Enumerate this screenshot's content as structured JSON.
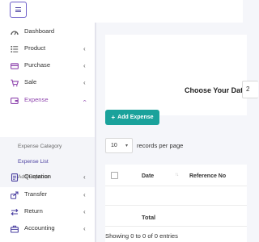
{
  "topbar": {
    "menu_icon": "hamburger-icon"
  },
  "sidebar": {
    "items": [
      {
        "label": "Dashboard",
        "icon": "gauge-icon",
        "has_submenu": false
      },
      {
        "label": "Product",
        "icon": "list-icon",
        "has_submenu": true
      },
      {
        "label": "Purchase",
        "icon": "card-icon",
        "has_submenu": true
      },
      {
        "label": "Sale",
        "icon": "cart-icon",
        "has_submenu": true
      },
      {
        "label": "Expense",
        "icon": "wallet-icon",
        "has_submenu": true,
        "expanded": true
      },
      {
        "label": "Quotation",
        "icon": "document-icon",
        "has_submenu": true
      },
      {
        "label": "Transfer",
        "icon": "share-icon",
        "has_submenu": true
      },
      {
        "label": "Return",
        "icon": "exchange-icon",
        "has_submenu": true
      },
      {
        "label": "Accounting",
        "icon": "briefcase-icon",
        "has_submenu": true
      }
    ],
    "expense_submenu": [
      "Expense Category",
      "Expense List",
      "Add Expense"
    ],
    "active_submenu_item": "Expense List",
    "accent_color": "#8e44ad"
  },
  "main": {
    "date_label": "Choose Your Date",
    "date_value": "2",
    "add_button_label": "Add Expense",
    "add_button_color": "#1aa29b",
    "records_select_value": "10",
    "records_per_page_text": "records per page",
    "table": {
      "columns": [
        "Date",
        "Reference No"
      ],
      "rows": [],
      "footer_label": "Total"
    },
    "info_text": "Showing 0 to 0 of 0 entries"
  }
}
